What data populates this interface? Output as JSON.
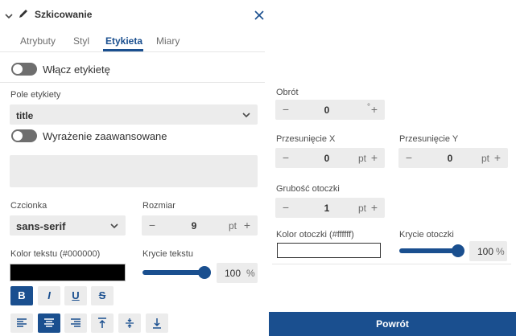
{
  "panel": {
    "title": "Szkicowanie"
  },
  "tabs": [
    "Atrybuty",
    "Styl",
    "Etykieta",
    "Miary"
  ],
  "active_tab": "Etykieta",
  "enable_label": {
    "label": "Włącz etykietę",
    "on": false
  },
  "label_field": {
    "label": "Pole etykiety",
    "value": "title"
  },
  "advanced_expression": {
    "label": "Wyrażenie zaawansowane",
    "on": false
  },
  "font": {
    "label": "Czcionka",
    "value": "sans-serif"
  },
  "size": {
    "label": "Rozmiar",
    "value": "9",
    "unit": "pt"
  },
  "text_color": {
    "label": "Kolor tekstu (#000000)",
    "color": "#000000"
  },
  "text_opacity": {
    "label": "Krycie tekstu",
    "value": "100",
    "unit": "%",
    "level": 1.0
  },
  "format_buttons": {
    "bold": "B",
    "italic": "I",
    "underline": "U",
    "strike": "S",
    "active": [
      "bold",
      "align-center"
    ]
  },
  "rotation": {
    "label": "Obrót",
    "value": "0",
    "unit": "°"
  },
  "offset_x": {
    "label": "Przesunięcie X",
    "value": "0",
    "unit": "pt"
  },
  "offset_y": {
    "label": "Przesunięcie Y",
    "value": "0",
    "unit": "pt"
  },
  "halo_size": {
    "label": "Grubość otoczki",
    "value": "1",
    "unit": "pt"
  },
  "halo_color": {
    "label": "Kolor otoczki (#ffffff)",
    "color": "#ffffff"
  },
  "halo_opacity": {
    "label": "Krycie otoczki",
    "value": "100",
    "unit": "%",
    "level": 1.0
  },
  "back_button": {
    "label": "Powrót"
  },
  "colors": {
    "accent": "#1a4f8f",
    "field_bg": "#ececec",
    "toggle_off": "#6e6e6e"
  }
}
